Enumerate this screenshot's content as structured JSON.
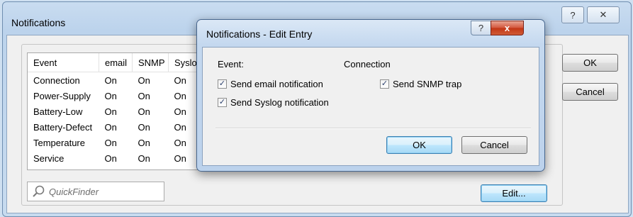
{
  "main_window": {
    "title": "Notifications",
    "help_glyph": "?",
    "close_glyph": "✕",
    "columns": [
      "Event",
      "email",
      "SNMP",
      "Syslo"
    ],
    "rows": [
      {
        "event": "Connection",
        "email": "On",
        "snmp": "On",
        "syslog": "On"
      },
      {
        "event": "Power-Supply",
        "email": "On",
        "snmp": "On",
        "syslog": "On"
      },
      {
        "event": "Battery-Low",
        "email": "On",
        "snmp": "On",
        "syslog": "On"
      },
      {
        "event": "Battery-Defect",
        "email": "On",
        "snmp": "On",
        "syslog": "On"
      },
      {
        "event": "Temperature",
        "email": "On",
        "snmp": "On",
        "syslog": "On"
      },
      {
        "event": "Service",
        "email": "On",
        "snmp": "On",
        "syslog": "On"
      }
    ],
    "ok_label": "OK",
    "cancel_label": "Cancel",
    "edit_label": "Edit...",
    "quickfinder_placeholder": "QuickFinder"
  },
  "dialog": {
    "title": "Notifications - Edit Entry",
    "help_glyph": "?",
    "close_glyph": "x",
    "event_label": "Event:",
    "event_value": "Connection",
    "send_email": {
      "label": "Send email notification",
      "checked": true
    },
    "send_snmp": {
      "label": "Send SNMP trap",
      "checked": true
    },
    "send_syslog": {
      "label": "Send Syslog notification",
      "checked": true
    },
    "ok_label": "OK",
    "cancel_label": "Cancel"
  },
  "colors": {
    "window_frame": "#c9dcf0",
    "close_red": "#c23615",
    "focus_blue": "#3c7fb1"
  }
}
